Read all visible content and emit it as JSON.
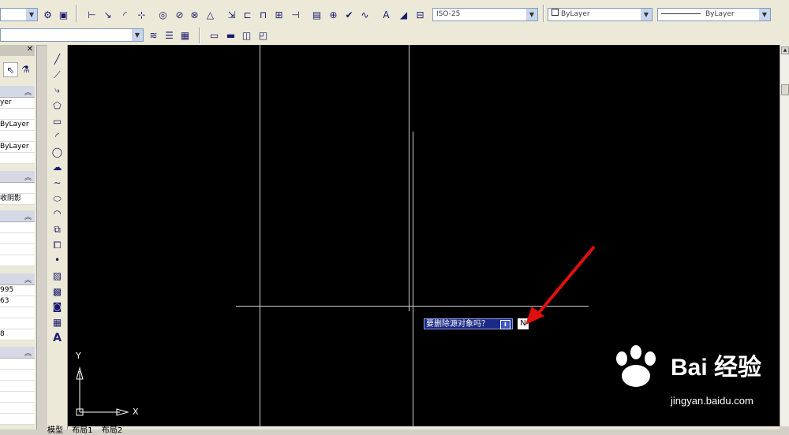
{
  "toolbar": {
    "dimstyle_combo": "ISO-25",
    "color_combo": "ByLayer",
    "linetype_combo": "ByLayer"
  },
  "properties": {
    "row1": "yer",
    "row2": "ByLayer",
    "row3": "ByLayer",
    "row4": "收阴影",
    "row5": "995",
    "row6": "63",
    "row7": "8"
  },
  "command": {
    "prompt": "要删除源对象吗？",
    "input": "N"
  },
  "ucs": {
    "x_label": "X",
    "y_label": "Y"
  },
  "layout_tabs": [
    "模型",
    "布局1",
    "布局2"
  ],
  "watermark": {
    "brand": "Bai 经验",
    "url": "jingyan.baidu.com"
  },
  "colors": {
    "canvas": "#000000",
    "prompt_bg": "#1b2a86",
    "annotation_arrow": "#e01010"
  }
}
